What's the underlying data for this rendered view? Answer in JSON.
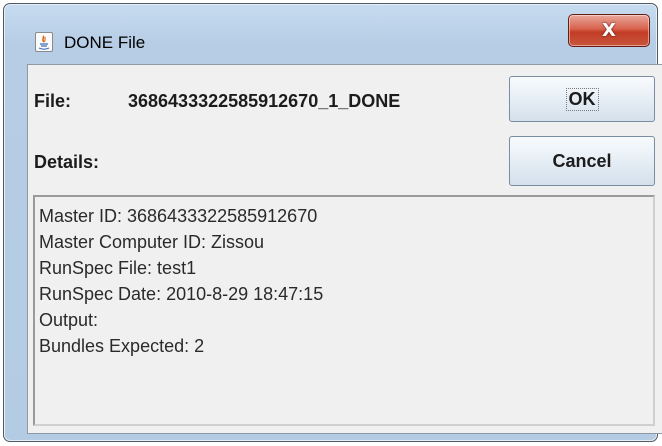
{
  "window": {
    "title": "DONE File",
    "close_glyph": "X",
    "app_icon": "java-icon"
  },
  "form": {
    "file_label": "File:",
    "file_value": "3686433322585912670_1_DONE",
    "details_label": "Details:"
  },
  "buttons": {
    "ok_label": "OK",
    "cancel_label": "Cancel"
  },
  "details": {
    "lines": [
      "Master ID: 3686433322585912670",
      "Master Computer ID: Zissou",
      "RunSpec File: test1",
      "RunSpec Date: 2010-8-29 18:47:15",
      "Output:",
      "Bundles Expected: 2"
    ]
  }
}
